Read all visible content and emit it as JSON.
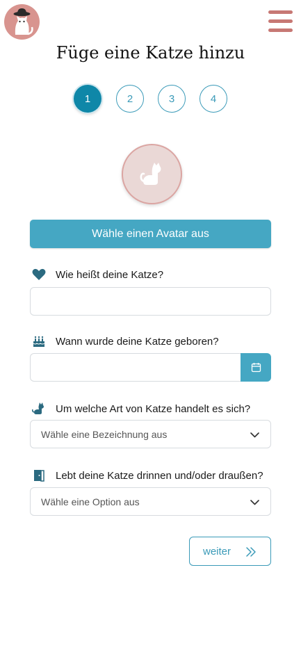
{
  "page": {
    "title": "Füge eine Katze hinzu"
  },
  "steps": [
    "1",
    "2",
    "3",
    "4"
  ],
  "avatar": {
    "button_label": "Wähle einen Avatar aus"
  },
  "form": {
    "name": {
      "label": "Wie heißt deine Katze?",
      "value": ""
    },
    "birth": {
      "label": "Wann wurde deine Katze geboren?",
      "value": ""
    },
    "breed": {
      "label": "Um welche Art von Katze handelt es sich?",
      "placeholder": "Wähle eine Bezeichnung aus"
    },
    "living": {
      "label": "Lebt deine Katze drinnen und/oder draußen?",
      "placeholder": "Wähle eine Option aus"
    }
  },
  "actions": {
    "next_label": "weiter"
  },
  "colors": {
    "primary": "#45a7c3",
    "accent": "#c77874",
    "active_step": "#0f87a8",
    "icon": "#2b6a80"
  },
  "icons": {
    "logo": "cat-with-hat-icon",
    "menu": "hamburger-menu-icon",
    "avatar": "cat-icon",
    "name": "heart-icon",
    "birth": "birthday-cake-icon",
    "breed": "cat-icon",
    "living": "door-icon",
    "calendar": "calendar-icon",
    "chevron": "chevron-down-icon",
    "next": "double-chevron-right-icon"
  }
}
